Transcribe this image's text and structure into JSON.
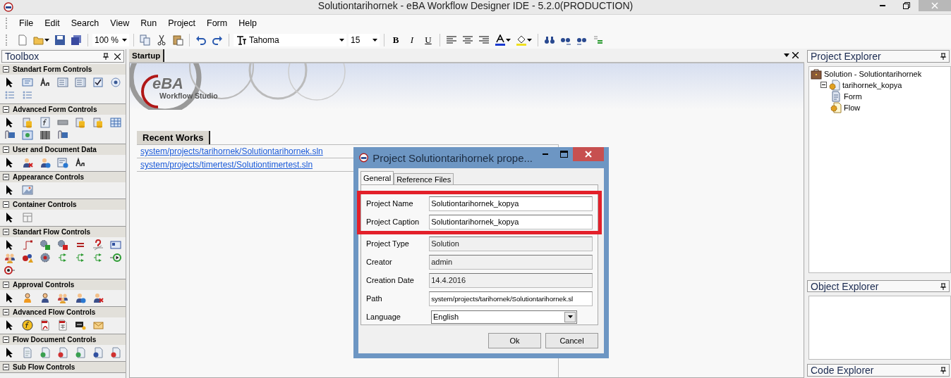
{
  "window": {
    "title": "Solutiontarihornek - eBA Workflow Designer IDE - 5.2.0(PRODUCTION)"
  },
  "menu": [
    "File",
    "Edit",
    "Search",
    "View",
    "Run",
    "Project",
    "Form",
    "Help"
  ],
  "toolbar": {
    "zoom": "100 %",
    "font": "Tahoma",
    "font_size": "15",
    "format_buttons": [
      "B",
      "I",
      "U"
    ]
  },
  "toolbox": {
    "title": "Toolbox",
    "sections": [
      {
        "title": "Standart Form Controls",
        "expanded": true
      },
      {
        "title": "Advanced Form Controls",
        "expanded": true
      },
      {
        "title": "User and Document Data",
        "expanded": true
      },
      {
        "title": "Appearance Controls",
        "expanded": true
      },
      {
        "title": "Container Controls",
        "expanded": true
      },
      {
        "title": "Standart Flow Controls",
        "expanded": true
      },
      {
        "title": "Approval Controls",
        "expanded": true
      },
      {
        "title": "Advanced Flow Controls",
        "expanded": true
      },
      {
        "title": "Flow Document Controls",
        "expanded": true
      },
      {
        "title": "Sub Flow Controls",
        "expanded": true
      }
    ]
  },
  "document_tabs": [
    {
      "label": "Startup",
      "selected": true
    }
  ],
  "startup": {
    "logo": {
      "brand": "eBA",
      "subtitle": "Workflow Studio"
    },
    "recent_works": {
      "title": "Recent Works",
      "links": [
        "system/projects/tarihornek/Solutiontarihornek.sln",
        "system/projects/timertest/Solutiontimertest.sln"
      ]
    }
  },
  "dialog": {
    "title": "Project Solutiontarihornek prope...",
    "tabs": [
      {
        "label": "General",
        "selected": true
      },
      {
        "label": "Reference Files",
        "selected": false
      }
    ],
    "fields": [
      {
        "label": "Project Name",
        "value": "Solutiontarihornek_kopya",
        "kind": "text",
        "disabled": false,
        "highlighted": true
      },
      {
        "label": "Project Caption",
        "value": "Solutiontarihornek_kopya",
        "kind": "text",
        "disabled": false,
        "highlighted": true
      },
      {
        "label": "Project Type",
        "value": "Solution",
        "kind": "text",
        "disabled": true,
        "highlighted": false
      },
      {
        "label": "Creator",
        "value": "admin",
        "kind": "text",
        "disabled": true,
        "highlighted": false
      },
      {
        "label": "Creation Date",
        "value": "14.4.2016",
        "kind": "text",
        "disabled": true,
        "highlighted": false
      },
      {
        "label": "Path",
        "value": "system/projects/tarihornek/Solutiontarihornek.sl",
        "kind": "text",
        "disabled": false,
        "highlighted": false
      },
      {
        "label": "Language",
        "value": "English",
        "kind": "dropdown",
        "disabled": false,
        "highlighted": false
      }
    ],
    "buttons": [
      "Ok",
      "Cancel"
    ]
  },
  "project_explorer": {
    "title": "Project Explorer",
    "tree": [
      {
        "label": "Solution - Solutiontarihornek",
        "kind": "solution",
        "children": [
          {
            "label": "tarihornek_kopya",
            "kind": "project",
            "expanded": true,
            "children": [
              {
                "label": "Form",
                "kind": "form"
              },
              {
                "label": "Flow",
                "kind": "flow"
              }
            ]
          }
        ]
      }
    ]
  },
  "object_explorer": {
    "title": "Object Explorer"
  },
  "code_explorer": {
    "title": "Code Explorer"
  }
}
